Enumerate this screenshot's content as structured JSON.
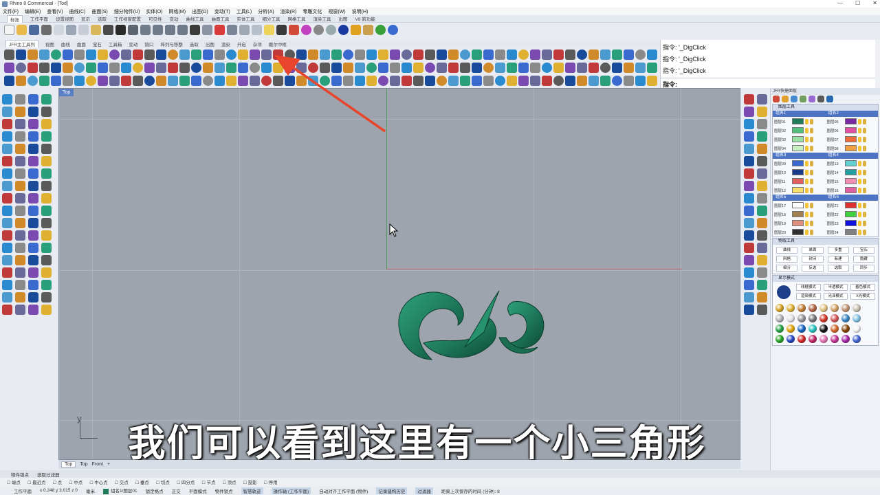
{
  "window": {
    "title": "Rhino 8 Commercial - [Tod]",
    "controls": [
      "—",
      "☐",
      "✕"
    ]
  },
  "menu": [
    "文件(F)",
    "编辑(E)",
    "查看(V)",
    "曲线(C)",
    "曲面(S)",
    "细分物件(U)",
    "实体(O)",
    "网格(M)",
    "出图(D)",
    "变动(T)",
    "工具(L)",
    "分析(A)",
    "渲染(R)",
    "零雕文化",
    "视窗(W)",
    "说明(H)"
  ],
  "toolbar_tabs": [
    "标准",
    "工作平面",
    "设置视图",
    "显示",
    "选取",
    "工作视窗配置",
    "可见性",
    "变动",
    "曲线工具",
    "曲面工具",
    "实体工具",
    "细分工具",
    "网格工具",
    "渲染工具",
    "出图",
    "V8 新功能"
  ],
  "jfr_tabs": [
    "JFR主工具列",
    "视图",
    "曲线",
    "曲面",
    "宝石",
    "工具箱",
    "变动",
    "镜口",
    "阵列与移整",
    "选取",
    "出图",
    "渲染",
    "开启",
    "杂项",
    "戴尔中框"
  ],
  "command_history": [
    "指令: '_DigClick",
    "指令: '_DigClick",
    "指令: '_DigClick"
  ],
  "command_prompt": "指令:",
  "viewport": {
    "label": "Top",
    "axis_label": "y",
    "model_color": "#1e7a5c"
  },
  "subtitle": "我们可以看到这里有一个小三角形",
  "viewport_tabs": [
    "Top",
    "Top",
    "Front",
    "+"
  ],
  "right_panel": {
    "title": "JFR快捷面板",
    "layer_tool_title": "图层工具",
    "layer_groups": [
      {
        "name": "组名1",
        "layers": [
          {
            "name": "图层01",
            "color": "#1f7a5a"
          },
          {
            "name": "图层02",
            "color": "#52c07a"
          },
          {
            "name": "图层03",
            "color": "#98e0a2"
          },
          {
            "name": "图层04",
            "color": "#c9f0c2"
          }
        ]
      },
      {
        "name": "组名2",
        "layers": [
          {
            "name": "图层05",
            "color": "#7a2aa0"
          },
          {
            "name": "图层06",
            "color": "#e04fa0"
          },
          {
            "name": "图层07",
            "color": "#f06a3a"
          },
          {
            "name": "图层08",
            "color": "#f0a040"
          }
        ]
      },
      {
        "name": "组名3",
        "layers": [
          {
            "name": "图层09",
            "color": "#3a6ad0"
          },
          {
            "name": "图层10",
            "color": "#1a3a8a"
          },
          {
            "name": "图层11",
            "color": "#e06060"
          },
          {
            "name": "图层12",
            "color": "#f7e070"
          }
        ]
      },
      {
        "name": "组名4",
        "layers": [
          {
            "name": "图层13",
            "color": "#60d0d0"
          },
          {
            "name": "图层14",
            "color": "#20a0a0"
          },
          {
            "name": "图层15",
            "color": "#f090b0"
          },
          {
            "name": "图层16",
            "color": "#e060a0"
          }
        ]
      },
      {
        "name": "组名5",
        "layers": [
          {
            "name": "图层17",
            "color": "#ffffff"
          },
          {
            "name": "图层18",
            "color": "#a08050"
          },
          {
            "name": "图层19",
            "color": "#e09080"
          },
          {
            "name": "图层20",
            "color": "#303030"
          }
        ]
      },
      {
        "name": "组名6",
        "layers": [
          {
            "name": "图层21",
            "color": "#e03030"
          },
          {
            "name": "图层22",
            "color": "#40d040"
          },
          {
            "name": "图层23",
            "color": "#1010e0"
          },
          {
            "name": "图层24",
            "color": "#808080"
          }
        ]
      }
    ],
    "object_tool_title": "物取工具",
    "object_buttons": [
      "曲线",
      "单面",
      "多重",
      "宝石",
      "网格",
      "封闭",
      "新建",
      "隐藏",
      "细分",
      "反选",
      "选取",
      "同步"
    ],
    "display_title": "显示模式",
    "display_buttons": [
      "线框模式",
      "半透模式",
      "着色模式",
      "渲染模式",
      "光泽模式",
      "X光模式"
    ],
    "ball_colors": [
      "#d4a020",
      "#e0b030",
      "#c07a30",
      "#b06040",
      "#e0c080",
      "#d0a060",
      "#c09070",
      "#c8c0b0",
      "#b0b0b0",
      "#e0e0e0",
      "#909090",
      "#707070",
      "#d03020",
      "#d05050",
      "#3080c0",
      "#80c0e0",
      "#20a040",
      "#e0a000",
      "#1060c0",
      "#20c0c0",
      "#101010",
      "#d06020",
      "#804000",
      "#f0f0f0",
      "#20a020",
      "#2040c0",
      "#d02020",
      "#c02060",
      "#e070b0",
      "#c03090",
      "#a020a0",
      "#4060d0"
    ]
  },
  "statusbar_tabs": [
    "物件锁点",
    "选取过滤器"
  ],
  "osnap_items": [
    "端点",
    "最近点",
    "点",
    "中点",
    "中心点",
    "交点",
    "垂点",
    "切点",
    "四分点",
    "节点",
    "顶点",
    "投影",
    "停用"
  ],
  "statusbar": {
    "cplane": "工作平面",
    "coords": "x 0.248  y 3.015  z 0",
    "units": "毫米",
    "layer": "组名1/图层01",
    "items": [
      "锁定格点",
      "正交",
      "平面模式",
      "物件锁点",
      "智慧轨迹",
      "操作轴 (工作平面)",
      "自动对齐工作平面 (物件)",
      "记录建构历史",
      "过滤器"
    ],
    "autosave": "距离上次保存的时间 (分钟): 8"
  }
}
